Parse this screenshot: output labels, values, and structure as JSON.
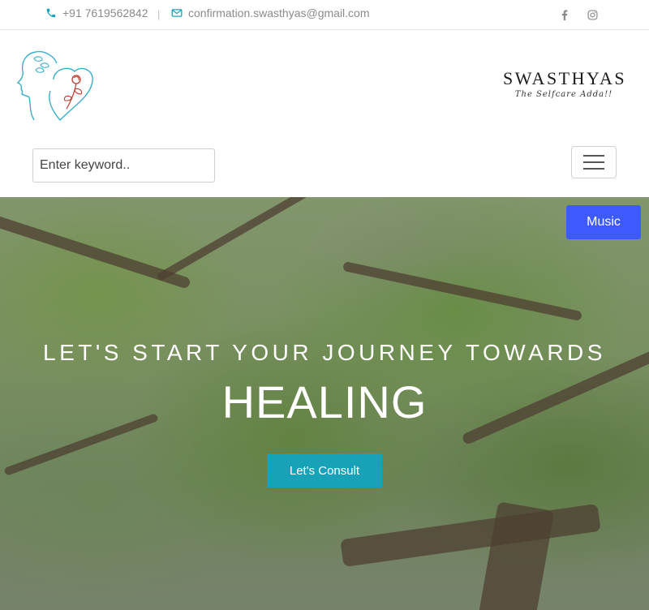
{
  "topbar": {
    "phone": "+91 7619562842",
    "separator": "|",
    "email": "confirmation.swasthyas@gmail.com",
    "phone_icon": "phone-icon",
    "email_icon": "envelope-icon",
    "social": [
      "facebook-icon",
      "instagram-icon"
    ]
  },
  "header": {
    "brand_name": "SWASTHYAS",
    "brand_tagline": "The Selfcare Adda!!",
    "search_placeholder": "Enter keyword..",
    "menu_icon": "hamburger-icon"
  },
  "hero": {
    "subtitle": "LET'S START YOUR JOURNEY TOWARDS",
    "title": "HEALING",
    "cta_label": "Let's Consult"
  },
  "music_label": "Music",
  "colors": {
    "accent_teal": "#17a2b8",
    "music_blue": "#3d5afe",
    "logo_blue": "#3aaecb",
    "logo_red": "#c0392b"
  }
}
